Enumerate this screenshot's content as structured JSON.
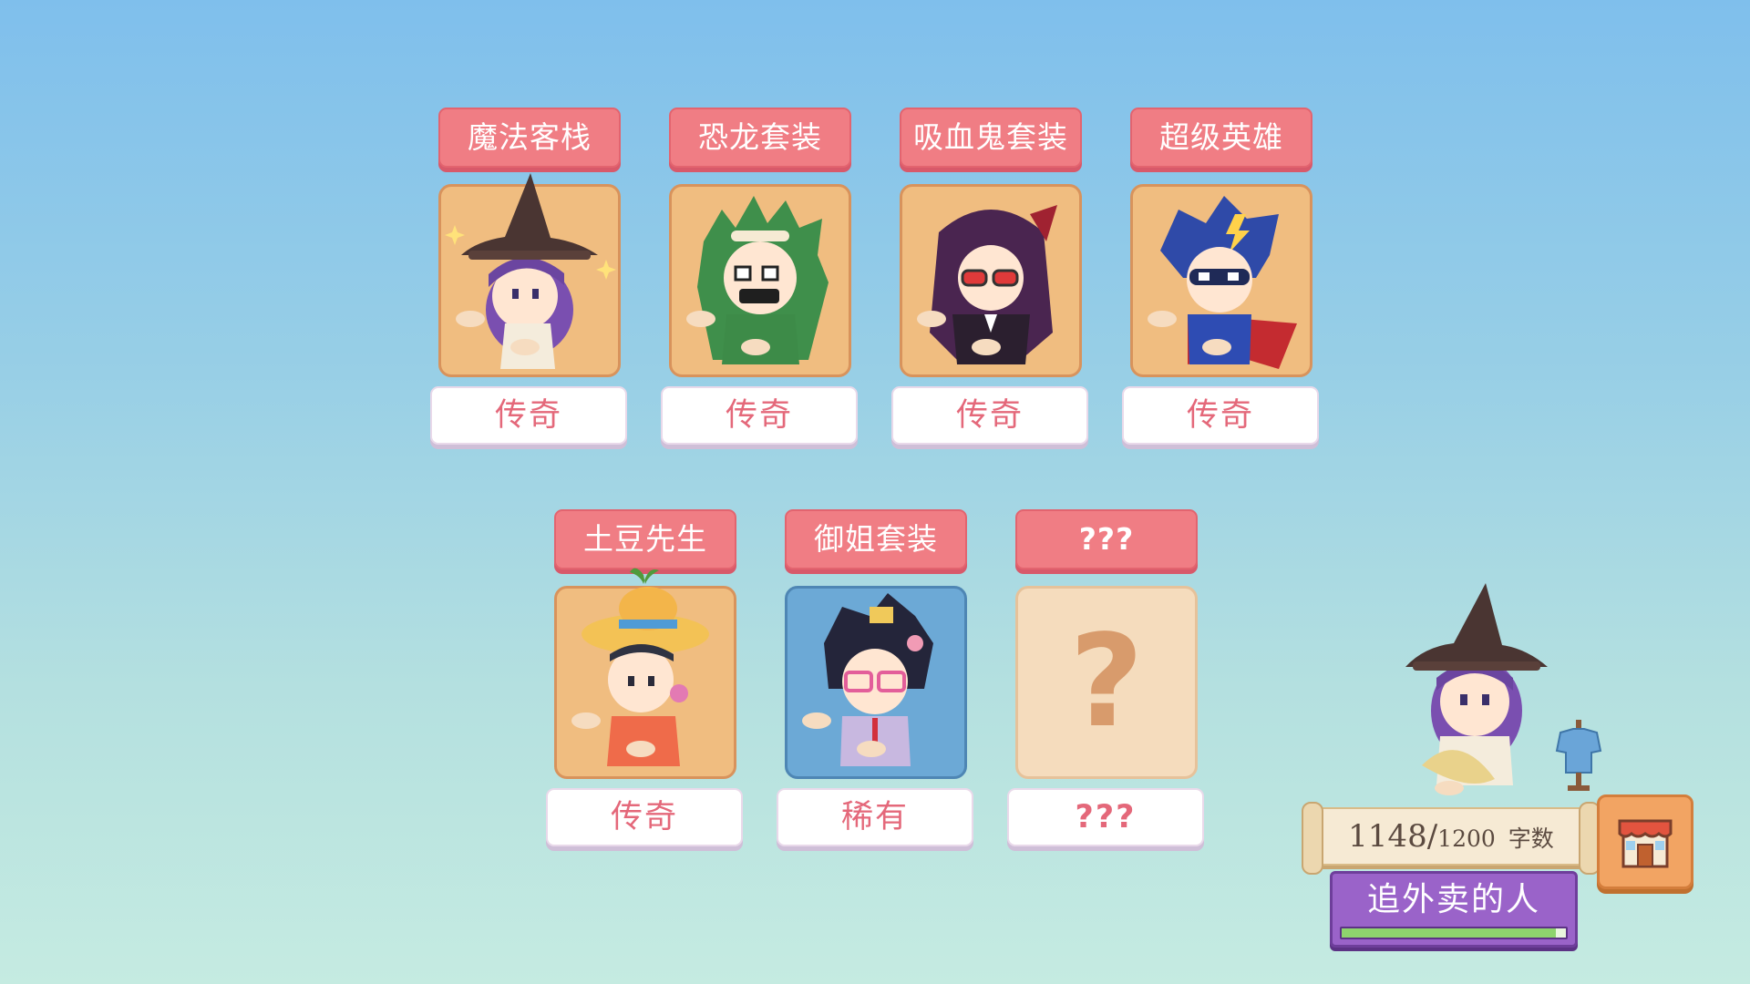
{
  "outfits": [
    {
      "name": "魔法客栈",
      "rarity": "传奇",
      "style": "legend",
      "portrait": "witch"
    },
    {
      "name": "恐龙套装",
      "rarity": "传奇",
      "style": "legend",
      "portrait": "dino"
    },
    {
      "name": "吸血鬼套装",
      "rarity": "传奇",
      "style": "legend",
      "portrait": "vampire"
    },
    {
      "name": "超级英雄",
      "rarity": "传奇",
      "style": "legend",
      "portrait": "hero"
    },
    {
      "name": "土豆先生",
      "rarity": "传奇",
      "style": "legend",
      "portrait": "potato"
    },
    {
      "name": "御姐套装",
      "rarity": "稀有",
      "style": "rare",
      "portrait": "lady"
    },
    {
      "name": "???",
      "rarity": "???",
      "style": "locked",
      "portrait": "unknown"
    }
  ],
  "hud": {
    "word_count_current": "1148",
    "word_count_separator": "/",
    "word_count_max": "1200",
    "word_count_unit": "字数",
    "character_name": "追外卖的人",
    "progress_fraction": 0.957,
    "shop_icon": "shop-icon",
    "wardrobe_icon": "wardrobe-icon"
  },
  "colors": {
    "title_bg": "#f07d84",
    "legend_bg": "#f0bd80",
    "rare_bg": "#6ca9d6",
    "locked_bg": "#f5dcbd",
    "rarity_text": "#e4687a",
    "name_plate": "#9a63c9"
  }
}
